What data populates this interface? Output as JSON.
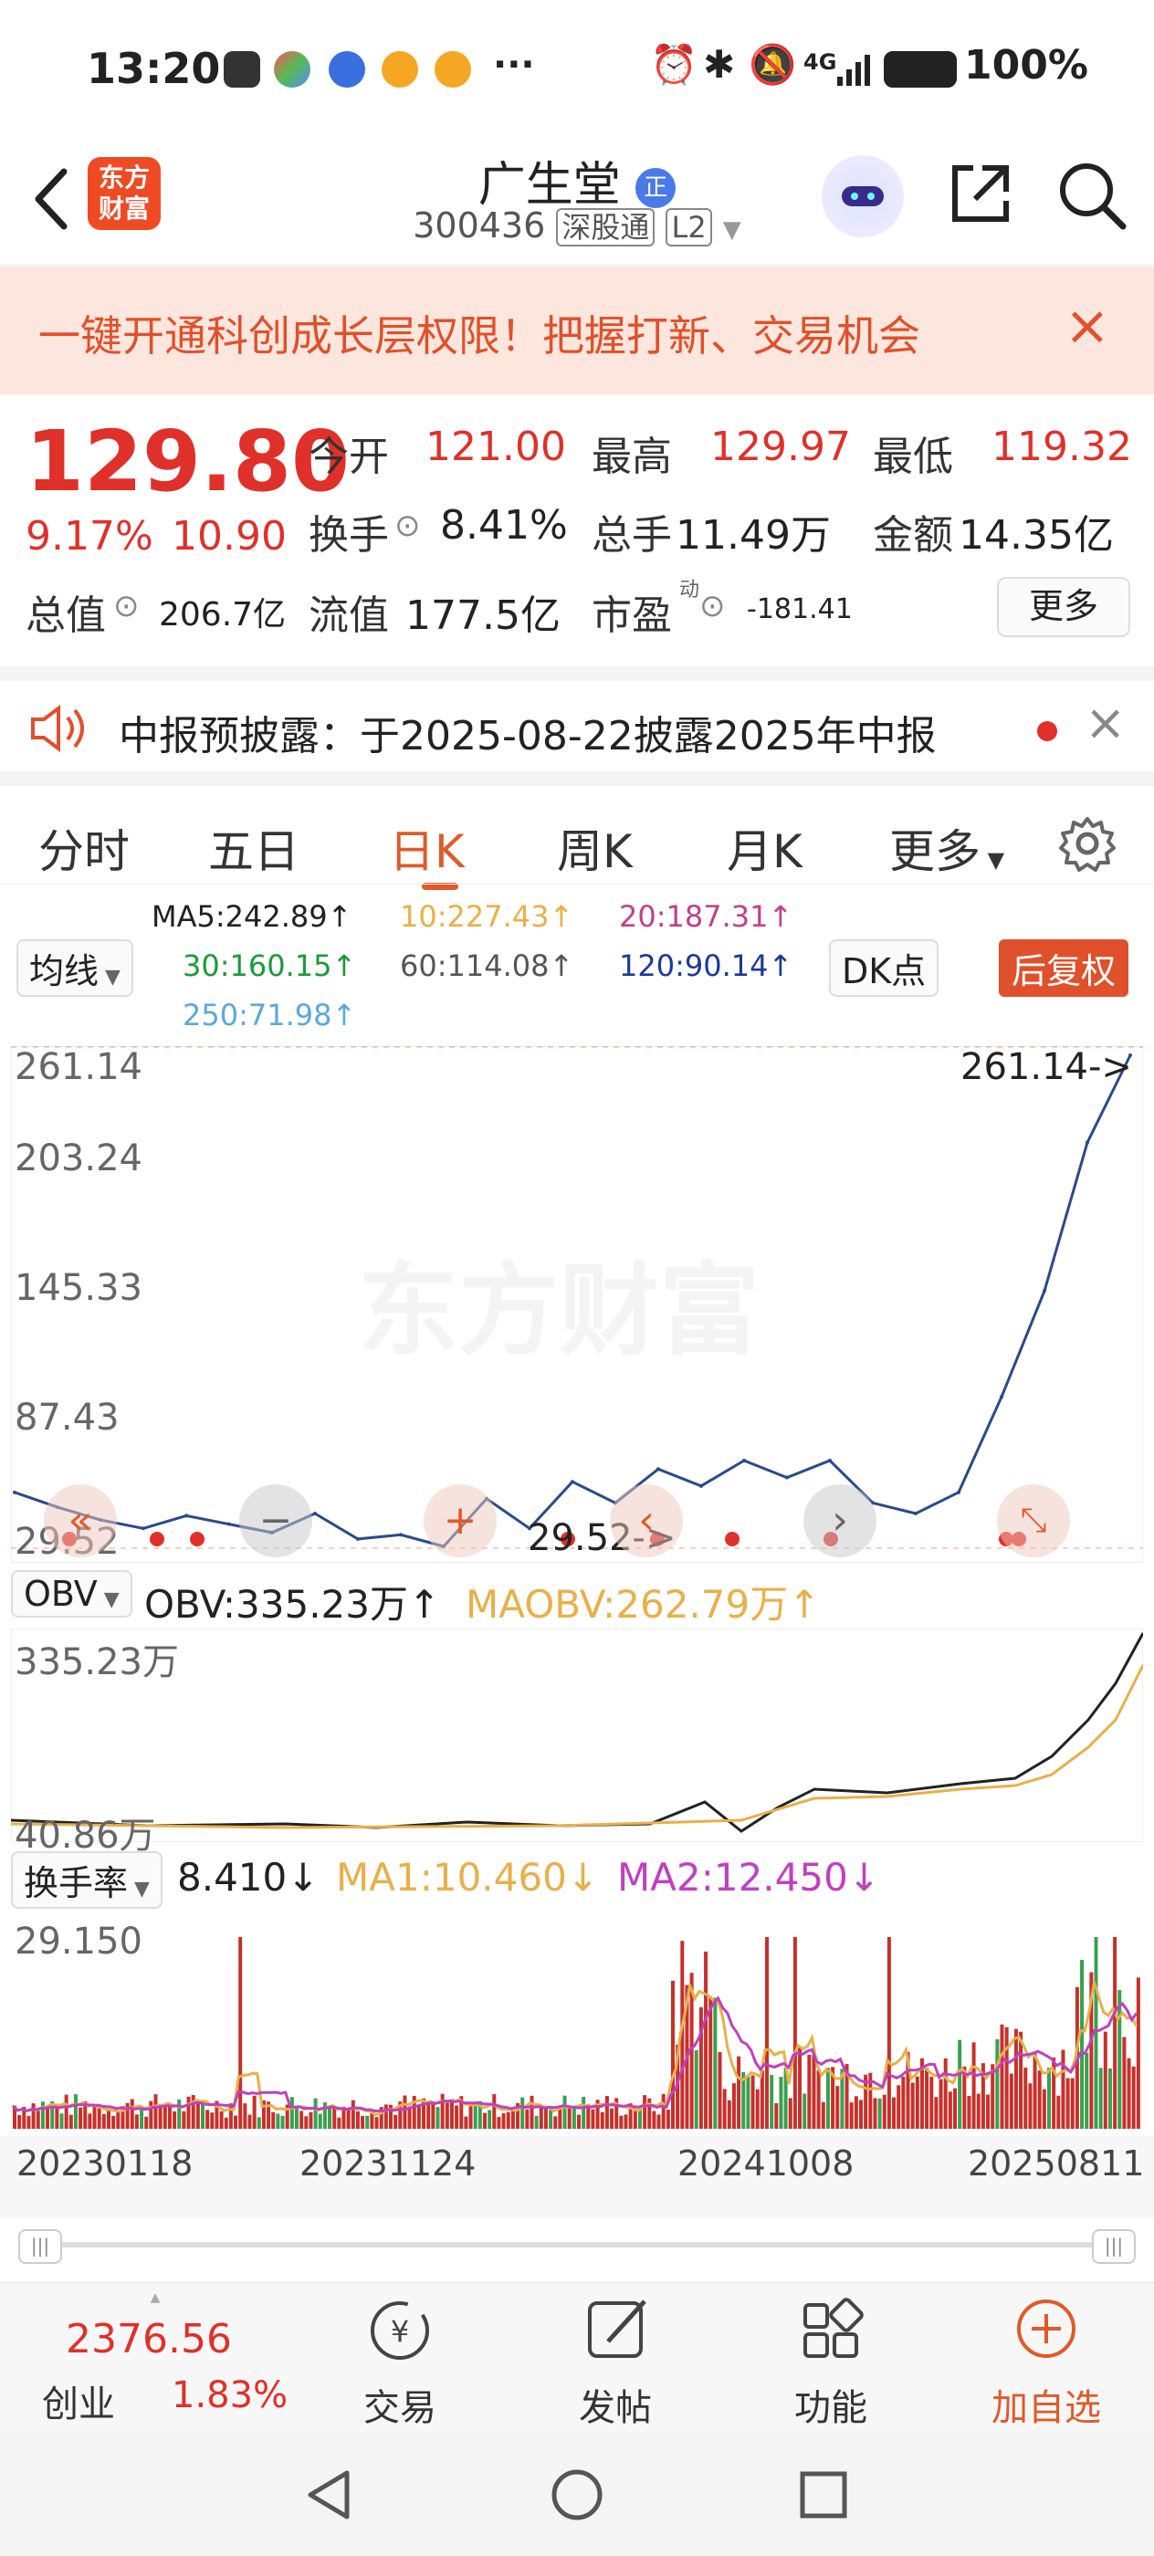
{
  "status_bar": {
    "time": "13:20",
    "battery": "100%",
    "network": "4G"
  },
  "header": {
    "logo_text_top": "东方",
    "logo_text_bottom": "财富",
    "stock_name": "广生堂",
    "badge": "正",
    "code": "300436",
    "tag_connect": "深股通",
    "tag_level": "L2"
  },
  "banner": {
    "text": "一键开通科创成长层权限！把握打新、交易机会",
    "close": "×"
  },
  "quote": {
    "price": "129.80",
    "change_pct": "9.17%",
    "change_amt": "10.90",
    "open_label": "今开",
    "open": "121.00",
    "high_label": "最高",
    "high": "129.97",
    "low_label": "最低",
    "low": "119.32",
    "turnover_label": "换手",
    "turnover": "8.41%",
    "volume_label": "总手",
    "volume": "11.49万",
    "amount_label": "金额",
    "amount": "14.35亿",
    "mktcap_label": "总值",
    "mktcap": "206.7亿",
    "float_label": "流值",
    "float": "177.5亿",
    "pe_label": "市盈",
    "pe_sup": "动",
    "pe": "-181.41",
    "more": "更多"
  },
  "notice": {
    "text": "中报预披露：于2025-08-22披露2025年中报",
    "close": "×"
  },
  "tabs": [
    "分时",
    "五日",
    "日K",
    "周K",
    "月K",
    "更多"
  ],
  "active_tab": "日K",
  "ma": {
    "selector": "均线",
    "ma5": "MA5:242.89↑",
    "ma10": "10:227.43↑",
    "ma20": "20:187.31↑",
    "ma30": "30:160.15↑",
    "ma60": "60:114.08↑",
    "ma120": "120:90.14↑",
    "ma250": "250:71.98↑",
    "dk": "DK点",
    "adjust": "后复权",
    "colors": {
      "ma5": "#222222",
      "ma10": "#e8b04a",
      "ma20": "#c0408a",
      "ma30": "#1a9a3a",
      "ma60": "#555555",
      "ma120": "#1a3a9a",
      "ma250": "#5aa8e0"
    }
  },
  "watermark": "东方财富",
  "main_chart": {
    "y_ticks": [
      "261.14",
      "203.24",
      "145.33",
      "87.43",
      "29.52"
    ],
    "max_marker": "261.14->",
    "min_marker": "29.52->",
    "line_color": "#2a4a8a"
  },
  "obv": {
    "selector": "OBV",
    "value": "OBV:335.23万↑",
    "ma": "MAOBV:262.79万↑",
    "top": "335.23万",
    "bottom": "40.86万"
  },
  "turnover_rate": {
    "selector": "换手率",
    "value": "8.410↓",
    "ma1": "MA1:10.460↓",
    "ma2": "MA2:12.450↓",
    "top": "29.150"
  },
  "dates": [
    "20230118",
    "20231124",
    "20241008",
    "20250811"
  ],
  "chart_data": [
    {
      "type": "line",
      "name": "日K",
      "y_ticks": [
        29.52,
        87.43,
        145.33,
        203.24,
        261.14
      ],
      "ylim": [
        29.52,
        261.14
      ],
      "x": [
        "20230118",
        "20231124",
        "20241008",
        "20250811"
      ],
      "series": [
        {
          "values": [
            55,
            48,
            42,
            38,
            44,
            40,
            36,
            45,
            33,
            35,
            29.52,
            52,
            38,
            60,
            50,
            66,
            58,
            70,
            62,
            70,
            50,
            45,
            55,
            100,
            150,
            220,
            261.14
          ]
        }
      ]
    }
  ],
  "bottom_bar": {
    "index_value": "2376.56",
    "index_name": "创业",
    "index_pct": "1.83%",
    "items": [
      "交易",
      "发帖",
      "功能",
      "加自选"
    ]
  }
}
